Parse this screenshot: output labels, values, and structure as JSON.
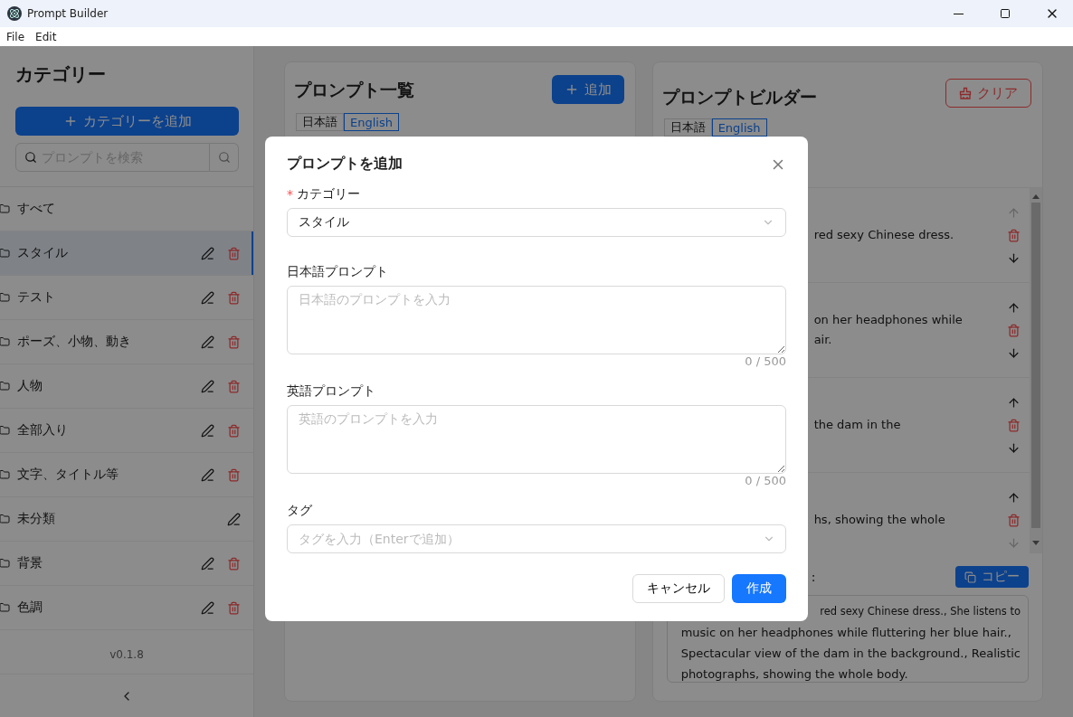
{
  "window": {
    "title": "Prompt Builder"
  },
  "menu": [
    {
      "label": "File"
    },
    {
      "label": "Edit"
    }
  ],
  "sidebar": {
    "title": "カテゴリー",
    "add_button": "カテゴリーを追加",
    "search": {
      "placeholder": "プロンプトを検索"
    },
    "items": [
      {
        "label": "すべて",
        "selected": false,
        "editable": false,
        "deletable": false
      },
      {
        "label": "スタイル",
        "selected": true,
        "editable": true,
        "deletable": true
      },
      {
        "label": "テスト",
        "selected": false,
        "editable": true,
        "deletable": true
      },
      {
        "label": "ポーズ、小物、動き",
        "selected": false,
        "editable": true,
        "deletable": true
      },
      {
        "label": "人物",
        "selected": false,
        "editable": true,
        "deletable": true
      },
      {
        "label": "全部入り",
        "selected": false,
        "editable": true,
        "deletable": true
      },
      {
        "label": "文字、タイトル等",
        "selected": false,
        "editable": true,
        "deletable": true
      },
      {
        "label": "未分類",
        "selected": false,
        "editable": true,
        "deletable": false
      },
      {
        "label": "背景",
        "selected": false,
        "editable": true,
        "deletable": true
      },
      {
        "label": "色調",
        "selected": false,
        "editable": true,
        "deletable": true
      }
    ],
    "version": "v0.1.8"
  },
  "prompt_list": {
    "title": "プロンプト一覧",
    "add_button": "追加",
    "languages": [
      {
        "label": "日本語",
        "selected": false
      },
      {
        "label": "English",
        "selected": true
      }
    ]
  },
  "builder": {
    "title": "プロンプトビルダー",
    "clear_button": "クリア",
    "languages": [
      {
        "label": "日本語",
        "selected": false
      },
      {
        "label": "English",
        "selected": true
      }
    ],
    "items": [
      {
        "lines": [
          "red sexy Chinese dress."
        ],
        "can_up": false,
        "can_down": true
      },
      {
        "lines": [
          "on her headphones while",
          "air."
        ],
        "can_up": true,
        "can_down": true
      },
      {
        "lines": [
          "the dam in the"
        ],
        "can_up": true,
        "can_down": true
      },
      {
        "lines": [
          "hs, showing the whole"
        ],
        "can_up": true,
        "can_down": false
      }
    ],
    "output_label": ":",
    "copy_button": "コピー",
    "output_lines": [
      "red sexy Chinese dress., She listens to",
      "music on her headphones while fluttering her blue hair.,",
      "Spectacular view of the dam in the background., Realistic",
      "photographs, showing the whole body."
    ]
  },
  "dialog": {
    "title": "プロンプトを追加",
    "fields": [
      {
        "kind": "select",
        "label": "カテゴリー",
        "required": true,
        "value": "スタイル"
      },
      {
        "kind": "textarea",
        "label": "日本語プロンプト",
        "required": false,
        "placeholder": "日本語のプロンプトを入力",
        "counter": "0 / 500"
      },
      {
        "kind": "textarea",
        "label": "英語プロンプト",
        "required": false,
        "placeholder": "英語のプロンプトを入力",
        "counter": "0 / 500"
      },
      {
        "kind": "tags",
        "label": "タグ",
        "required": false,
        "placeholder": "タグを入力（Enterで追加）"
      }
    ],
    "required_mark": "*",
    "cancel_button": "キャンセル",
    "submit_button": "作成"
  }
}
